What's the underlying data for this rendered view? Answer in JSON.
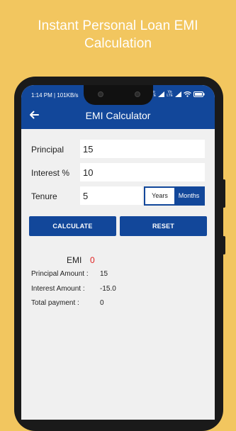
{
  "promo": {
    "line1": "Instant Personal Loan EMI",
    "line2": "Calculation"
  },
  "status_bar": {
    "time_speed": "1:14 PM | 101KB/s",
    "network_right": "Vo LTE",
    "network_left": "Vo LTE"
  },
  "app_bar": {
    "title": "EMI Calculator",
    "back_icon": "arrow-back-icon"
  },
  "form": {
    "principal_label": "Principal",
    "principal_value": "15",
    "interest_label": "Interest %",
    "interest_value": "10",
    "tenure_label": "Tenure",
    "tenure_value": "5",
    "unit_years": "Years",
    "unit_months": "Months",
    "selected_unit": "Months"
  },
  "buttons": {
    "calculate": "CALCULATE",
    "reset": "RESET"
  },
  "results": {
    "emi_label": "EMI",
    "emi_value": "0",
    "principal_amount_label": "Principal Amount :",
    "principal_amount_value": "15",
    "interest_amount_label": "Interest Amount :",
    "interest_amount_value": "-15.0",
    "total_payment_label": "Total payment :",
    "total_payment_value": "0"
  },
  "colors": {
    "background": "#f2c65f",
    "primary": "#12479a",
    "emi_value": "#e02020"
  }
}
